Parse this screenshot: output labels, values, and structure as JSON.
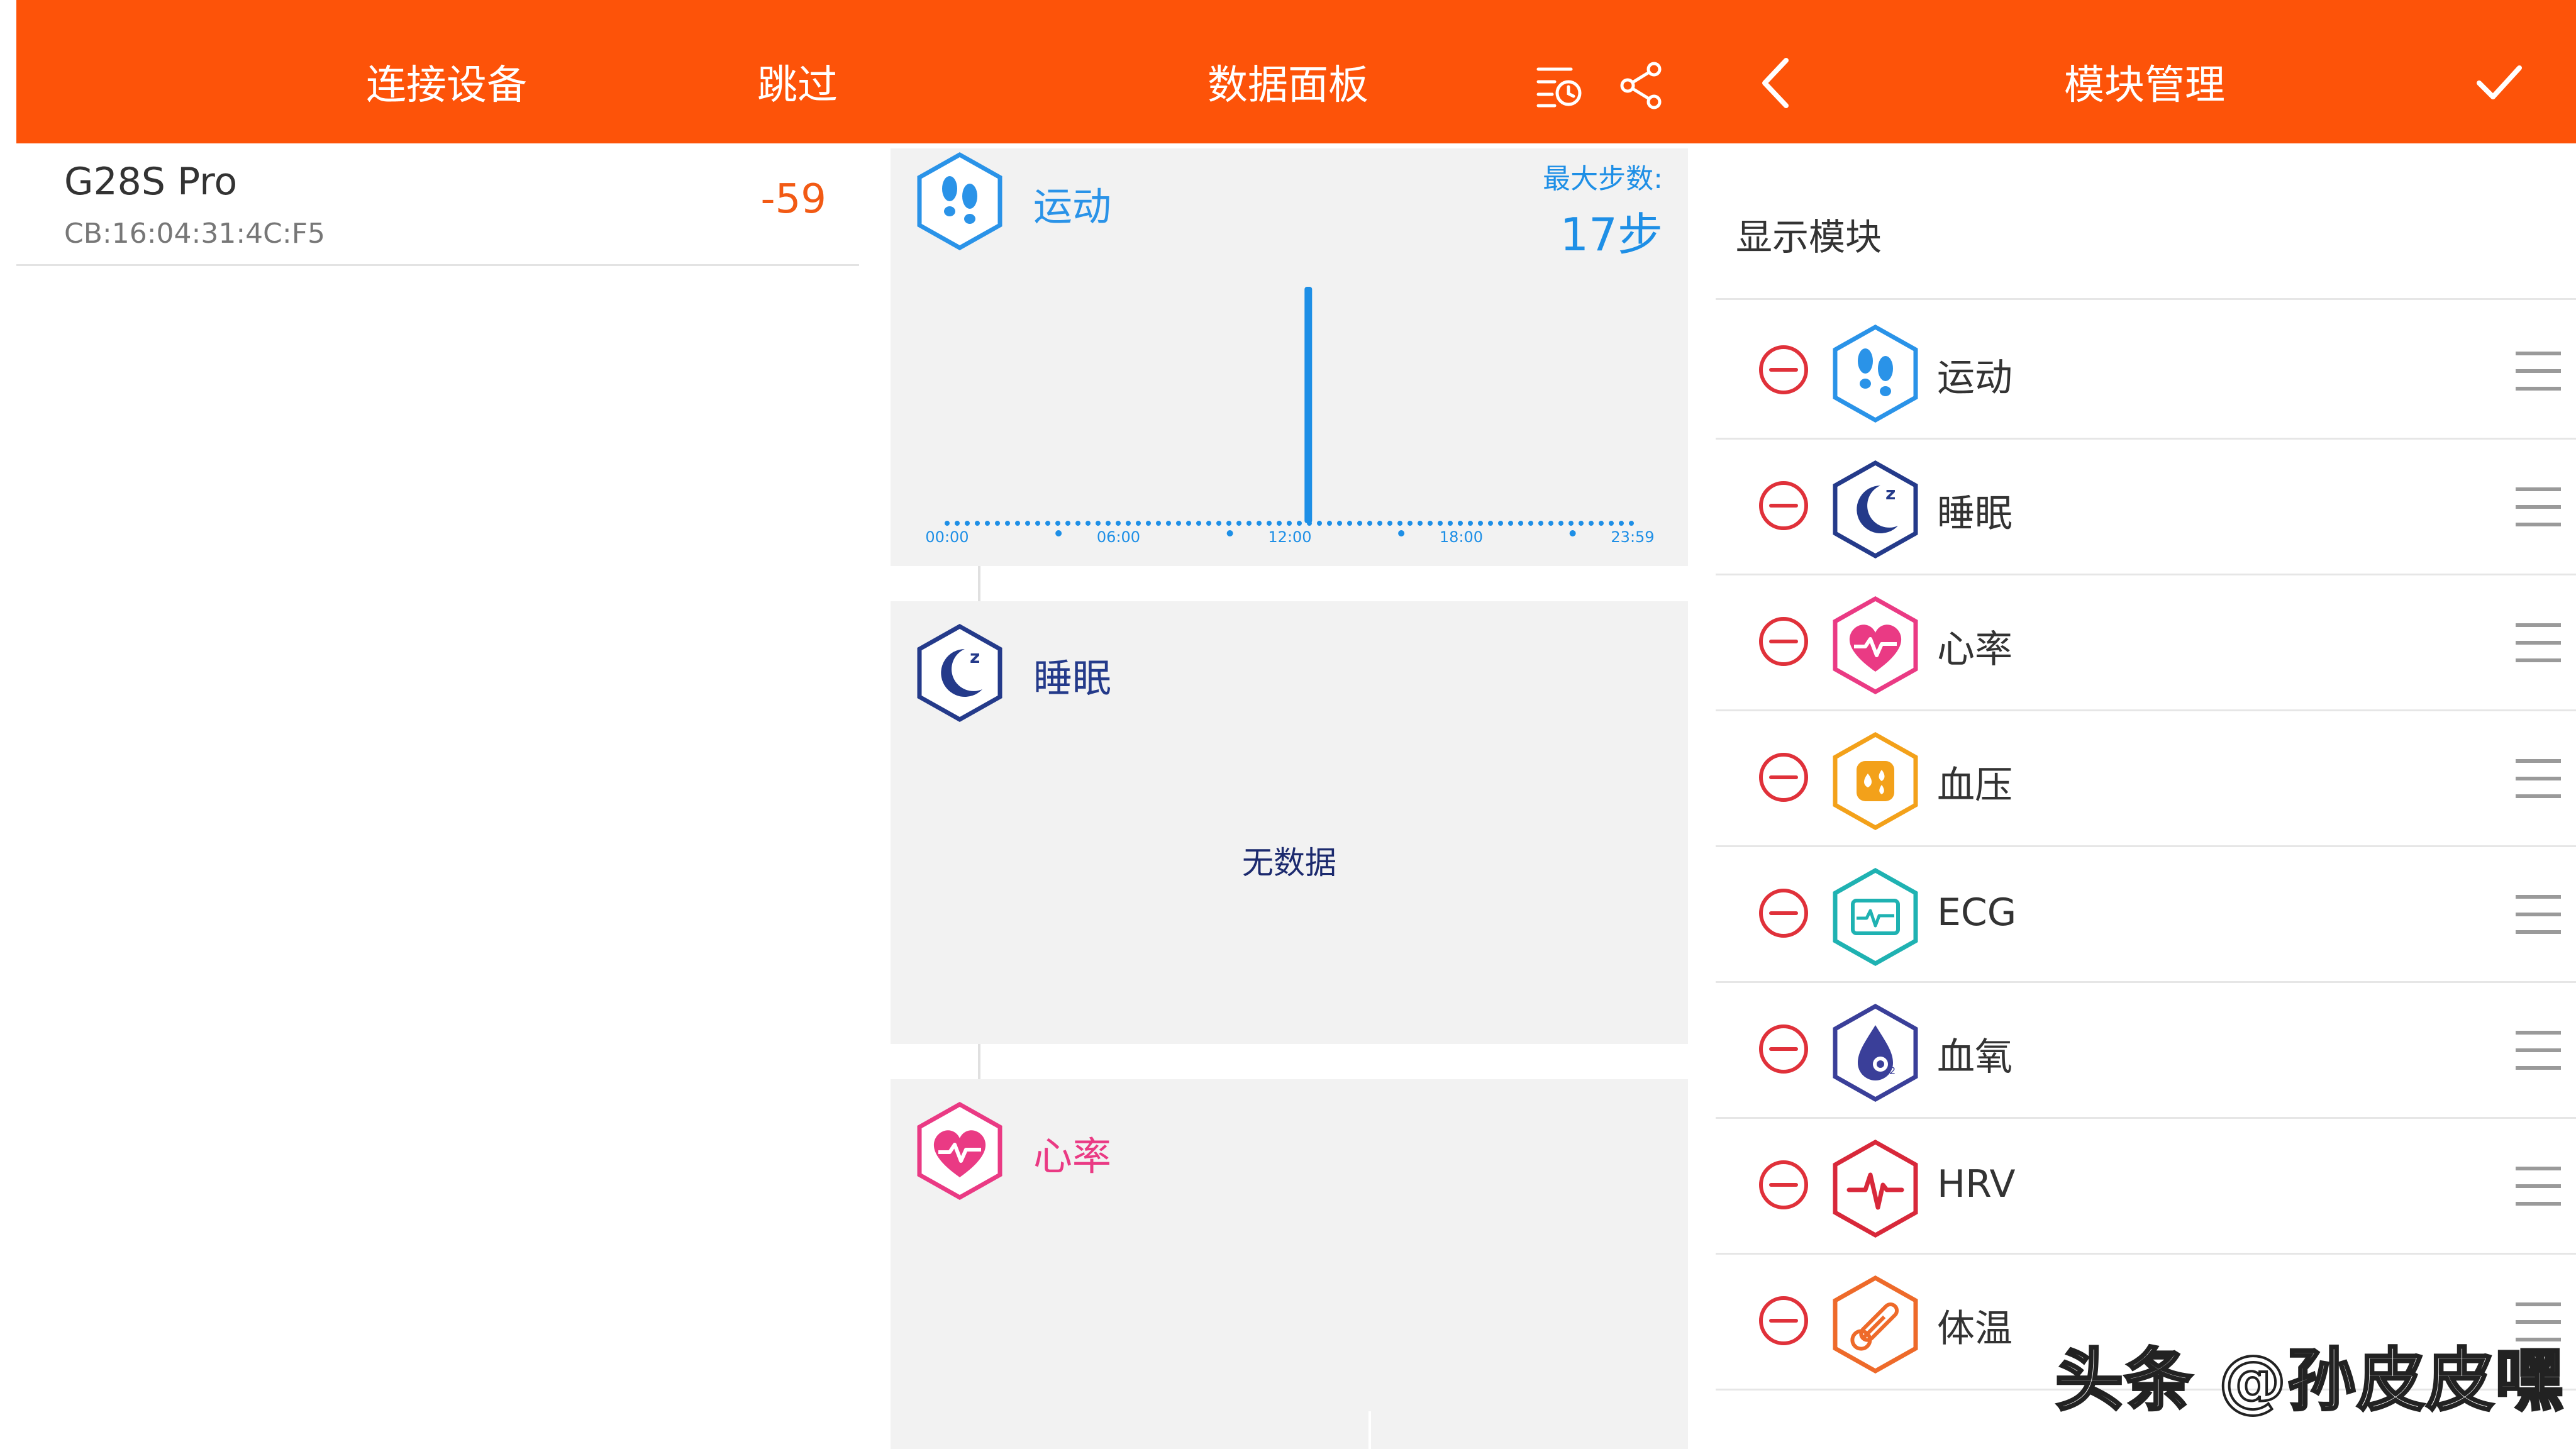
{
  "colors": {
    "header": "#fd5309",
    "accent_blue": "#1e8fe6",
    "minus_red": "#e0313a"
  },
  "connect": {
    "title": "连接设备",
    "skip": "跳过",
    "device": {
      "name": "G28S Pro",
      "mac": "CB:16:04:31:4C:F5",
      "rssi": "-59"
    }
  },
  "dashboard": {
    "title": "数据面板",
    "icons": [
      "history-clock-icon",
      "share-icon"
    ],
    "cards": [
      {
        "title": "运动",
        "icon": "footprints-icon",
        "max_label": "最大步数:",
        "max_value": "17步",
        "chart_data": {
          "type": "bar",
          "xlabel": "",
          "ylabel": "",
          "x_ticks": [
            "00:00",
            "06:00",
            "12:00",
            "18:00",
            "23:59"
          ],
          "spike_at": "~11:30",
          "peak_value": 17
        }
      },
      {
        "title": "睡眠",
        "icon": "moon-icon",
        "empty_text": "无数据"
      },
      {
        "title": "心率",
        "icon": "heart-rate-icon"
      }
    ]
  },
  "modules": {
    "title": "模块管理",
    "section_label": "显示模块",
    "items": [
      {
        "label": "运动",
        "icon": "footprints-icon",
        "color": "#2a93e8"
      },
      {
        "label": "睡眠",
        "icon": "moon-icon",
        "color": "#243a8a"
      },
      {
        "label": "心率",
        "icon": "heart-rate-icon",
        "color": "#ea3a84"
      },
      {
        "label": "血压",
        "icon": "blood-pressure-icon",
        "color": "#f3a11a"
      },
      {
        "label": "ECG",
        "icon": "ecg-icon",
        "color": "#1fb2b2"
      },
      {
        "label": "血氧",
        "icon": "blood-oxygen-icon",
        "color": "#3a3f99"
      },
      {
        "label": "HRV",
        "icon": "hrv-icon",
        "color": "#d8283a"
      },
      {
        "label": "体温",
        "icon": "thermometer-icon",
        "color": "#ee6a2a"
      }
    ]
  },
  "watermark": "头条 @孙皮皮嘿"
}
